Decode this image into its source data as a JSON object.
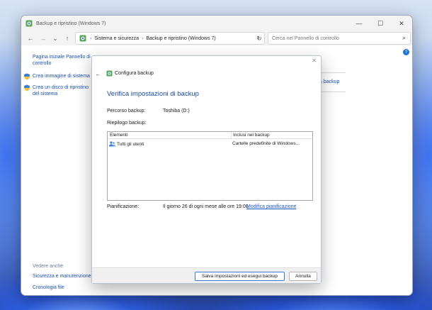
{
  "window": {
    "title": "Backup e ripristino (Windows 7)",
    "controls": {
      "minimize": "—",
      "maximize": "☐",
      "close": "✕"
    }
  },
  "navbar": {
    "back": "←",
    "forward": "→",
    "recent": "⌄",
    "up": "↑",
    "breadcrumbs": [
      "Sistema e sicurezza",
      "Backup e ripristino (Windows 7)"
    ],
    "separator": "›",
    "address_dropdown": "⌄",
    "refresh": "↻",
    "search_placeholder": "Cerca nel Pannello di controllo",
    "search_icon": "⌕"
  },
  "help": {
    "icon": "?"
  },
  "sidebar": {
    "home_link": "Pagina iniziale Pannello di controllo",
    "items": [
      {
        "label": "Crea immagine di sistema",
        "icon": "shield-icon"
      },
      {
        "label": "Crea un disco di ripristino del sistema",
        "icon": "shield-icon"
      }
    ],
    "see_also_title": "Vedere anche",
    "see_also": [
      {
        "label": "Sicurezza e manutenzione"
      },
      {
        "label": "Cronologia file"
      }
    ]
  },
  "main": {
    "partial_link": "a backup"
  },
  "dialog": {
    "close": "✕",
    "back": "←",
    "header": "Configura backup",
    "heading": "Verifica impostazioni di backup",
    "backup_path_label": "Percorso backup:",
    "backup_path_value": "Toshiba (D:)",
    "summary_label": "Riepilogo backup:",
    "table": {
      "columns": [
        "Elementi",
        "Inclusi nel backup"
      ],
      "rows": [
        {
          "item": "Tutti gli utenti",
          "included": "Cartelle predefinite di Windows..."
        }
      ]
    },
    "schedule_label": "Pianificazione:",
    "schedule_value": "Il giorno 26 di ogni mese alle ore 19:00",
    "schedule_link": "Modifica pianificazione",
    "buttons": {
      "save": "Salva impostazioni ed esegui backup",
      "cancel": "Annulla"
    }
  },
  "colors": {
    "link": "#1a4fb0",
    "heading": "#1b4ea3",
    "window_bg": "#ffffff",
    "chrome_bg": "#f3f3f3",
    "accent_button_border": "#3a7bd5"
  }
}
